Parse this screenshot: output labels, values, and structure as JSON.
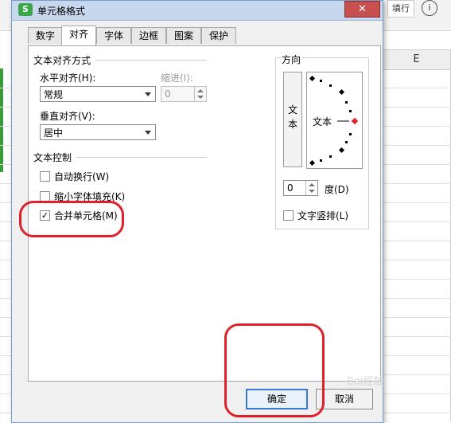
{
  "sheet": {
    "toolbar_btn": "填行",
    "info_icon": "i",
    "column_e": "E"
  },
  "dialog": {
    "app_icon_letter": "S",
    "title": "单元格格式",
    "close": "✕",
    "tabs": [
      "数字",
      "对齐",
      "字体",
      "边框",
      "图案",
      "保护"
    ],
    "active_tab": "对齐",
    "text_alignment": {
      "group_title": "文本对齐方式",
      "horizontal_label": "水平对齐(H):",
      "horizontal_value": "常规",
      "indent_label": "缩进(I):",
      "indent_value": "0",
      "vertical_label": "垂直对齐(V):",
      "vertical_value": "居中"
    },
    "text_control": {
      "group_title": "文本控制",
      "wrap_text": "自动换行(W)",
      "wrap_checked": false,
      "shrink_to_fit": "缩小字体填充(K)",
      "shrink_checked": false,
      "merge_cells": "合并单元格(M)",
      "merge_checked": true,
      "check_mark": "✓"
    },
    "orientation": {
      "group_title": "方向",
      "vertical_text_char1": "文",
      "vertical_text_char2": "本",
      "dial_label": "文本",
      "degrees_value": "0",
      "degrees_label": "度(D)",
      "vertical_stack_label": "文字竖排(L)",
      "vertical_stack_checked": false
    },
    "buttons": {
      "ok": "确定",
      "cancel": "取消"
    },
    "accent_color": "#3b78d6",
    "highlight_color": "#e0202a"
  },
  "watermark": "Bai經驗"
}
